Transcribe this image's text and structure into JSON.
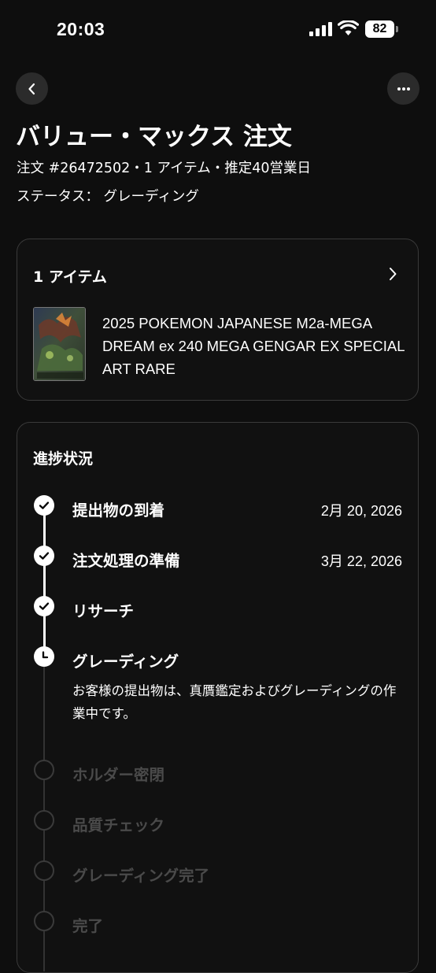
{
  "status_bar": {
    "time": "20:03",
    "battery": "82"
  },
  "header": {
    "title": "バリュー・マックス 注文",
    "meta": "注文 #26472502・1 アイテム・推定40営業日",
    "status": "ステータス： グレーディング"
  },
  "items_card": {
    "header": "1 アイテム",
    "item_name": "2025 POKEMON JAPANESE M2a-MEGA DREAM ex 240 MEGA GENGAR EX SPECIAL ART RARE"
  },
  "progress": {
    "title": "進捗状況",
    "steps": [
      {
        "label": "提出物の到着",
        "date": "2月 20, 2026",
        "state": "done"
      },
      {
        "label": "注文処理の準備",
        "date": "3月 22, 2026",
        "state": "done"
      },
      {
        "label": "リサーチ",
        "state": "done"
      },
      {
        "label": "グレーディング",
        "state": "current",
        "description": "お客様の提出物は、真贋鑑定およびグレーディングの作業中です。"
      },
      {
        "label": "ホルダー密閉",
        "state": "pending"
      },
      {
        "label": "品質チェック",
        "state": "pending"
      },
      {
        "label": "グレーディング完了",
        "state": "pending"
      },
      {
        "label": "完了",
        "state": "pending"
      }
    ]
  }
}
